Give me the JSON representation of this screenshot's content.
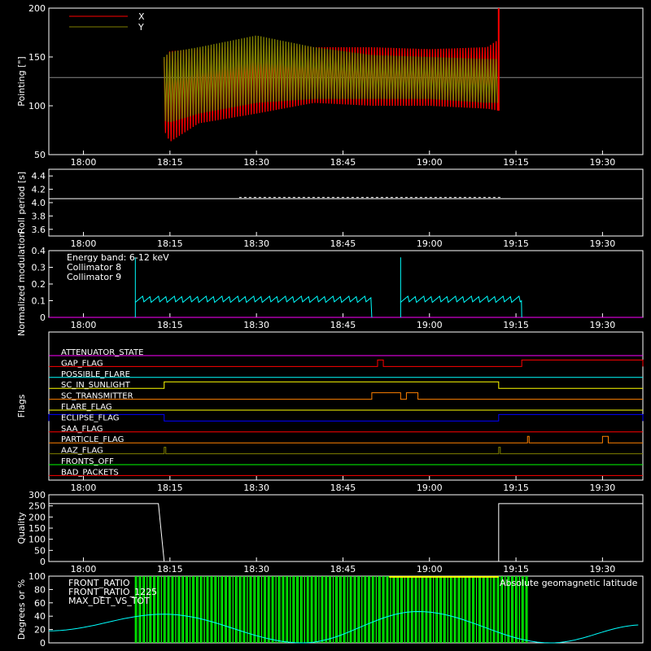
{
  "colors": {
    "background": "#000000",
    "axes": "#ffffff",
    "x_pointing": "#ff0000",
    "y_pointing": "#808000",
    "collimator8": "#00ffff",
    "collimator9": "#ff00ff",
    "front_ratio": "#ffff00",
    "front_ratio_1225": "#00ff00",
    "max_det": "#ff8000",
    "geomag": "#00ffff"
  },
  "time_axis": {
    "start": "17:54",
    "end": "19:37",
    "ticks": [
      "18:00",
      "18:15",
      "18:30",
      "18:45",
      "19:00",
      "19:15",
      "19:30"
    ]
  },
  "chart_data": [
    {
      "type": "line",
      "ylabel": "Pointing [\"]",
      "ylim": [
        50,
        200
      ],
      "yticks": [
        "50",
        "100",
        "150",
        "200"
      ],
      "legend_position": "top-left",
      "reference_line": 129,
      "series": [
        {
          "name": "X",
          "color": "#ff0000",
          "x": [
            "18:14",
            "18:15",
            "18:20",
            "18:30",
            "18:40",
            "18:50",
            "19:00",
            "19:10",
            "19:12"
          ],
          "upper": [
            148,
            156,
            158,
            162,
            160,
            160,
            158,
            160,
            168
          ],
          "lower": [
            75,
            63,
            82,
            92,
            103,
            100,
            100,
            97,
            95
          ]
        },
        {
          "name": "Y",
          "color": "#808000",
          "x": [
            "18:14",
            "18:15",
            "18:20",
            "18:30",
            "18:40",
            "18:50",
            "19:00",
            "19:10",
            "19:12"
          ],
          "upper": [
            150,
            155,
            160,
            172,
            160,
            152,
            150,
            148,
            148
          ],
          "lower": [
            85,
            83,
            92,
            103,
            107,
            107,
            107,
            103,
            103
          ]
        }
      ]
    },
    {
      "type": "line",
      "ylabel": "Roll period [s]",
      "ylim": [
        3.5,
        4.5
      ],
      "yticks": [
        "3.6",
        "3.8",
        "4.0",
        "4.2",
        "4.4"
      ],
      "series": [
        {
          "name": "",
          "x": [
            "17:54",
            "18:27",
            "19:12",
            "19:37"
          ],
          "values": [
            4.06,
            4.06,
            4.06,
            4.06
          ]
        }
      ]
    },
    {
      "type": "line",
      "ylabel": "Normalized modulation",
      "ylim": [
        0,
        0.4
      ],
      "yticks": [
        "0",
        "0.1",
        "0.2",
        "0.3",
        "0.4"
      ],
      "annotation": "Energy band: 6-12 keV",
      "series": [
        {
          "name": "Collimator 8",
          "color": "#00ffff",
          "x": [
            "18:09",
            "18:09",
            "18:50",
            "18:50",
            "18:55",
            "18:55",
            "19:16",
            "19:16"
          ],
          "values": [
            0,
            0.11,
            0.11,
            0,
            0,
            0.11,
            0.11,
            0
          ]
        },
        {
          "name": "Collimator 9",
          "color": "#ff00ff",
          "x": [
            "17:54",
            "19:37"
          ],
          "values": [
            0,
            0
          ]
        }
      ]
    },
    {
      "type": "line",
      "ylabel": "Flags",
      "series": [
        {
          "name": "ATTENUATOR_STATE",
          "color": "#ff00ff",
          "steps": []
        },
        {
          "name": "GAP_FLAG",
          "color": "#ff0000",
          "steps": [
            [
              "18:51",
              "18:52"
            ],
            [
              "19:16",
              "19:37"
            ]
          ]
        },
        {
          "name": "POSSIBLE_FLARE",
          "color": "#00ffff",
          "steps": []
        },
        {
          "name": "SC_IN_SUNLIGHT",
          "color": "#ffff00",
          "steps": [
            [
              "18:14",
              "19:12"
            ]
          ]
        },
        {
          "name": "SC_TRANSMITTER",
          "color": "#ff8000",
          "steps": [
            [
              "18:50",
              "18:55"
            ],
            [
              "18:56",
              "18:58"
            ]
          ]
        },
        {
          "name": "FLARE_FLAG",
          "color": "#ffff00",
          "steps": []
        },
        {
          "name": "ECLIPSE_FLAG",
          "color": "#0000ff",
          "steps": [
            [
              "17:54",
              "18:14"
            ],
            [
              "19:12",
              "19:37"
            ]
          ]
        },
        {
          "name": "SAA_FLAG",
          "color": "#ff0000",
          "steps": []
        },
        {
          "name": "PARTICLE_FLAG",
          "color": "#ff8000",
          "steps": [
            [
              "19:17",
              "19:17"
            ],
            [
              "19:30",
              "19:31"
            ]
          ]
        },
        {
          "name": "AAZ_FLAG",
          "color": "#808000",
          "steps": [
            [
              "18:14",
              "18:14"
            ],
            [
              "19:12",
              "19:12"
            ]
          ]
        },
        {
          "name": "FRONTS_OFF",
          "color": "#00ff00",
          "steps": []
        },
        {
          "name": "BAD_PACKETS",
          "color": "#ff0000",
          "steps": []
        }
      ]
    },
    {
      "type": "line",
      "ylabel": "Quality",
      "ylim": [
        0,
        300
      ],
      "yticks": [
        "0",
        "50",
        "100",
        "150",
        "200",
        "250",
        "300"
      ],
      "series": [
        {
          "name": "",
          "x": [
            "17:54",
            "18:13",
            "18:14",
            "19:12",
            "19:12",
            "19:37"
          ],
          "values": [
            260,
            260,
            0,
            0,
            260,
            260
          ]
        }
      ]
    },
    {
      "type": "area",
      "ylabel": "Degrees or %",
      "ylim": [
        0,
        100
      ],
      "yticks": [
        "0",
        "20",
        "40",
        "60",
        "80",
        "100"
      ],
      "series": [
        {
          "name": "FRONT_RATIO",
          "color": "#ffff00"
        },
        {
          "name": "FRONT_RATIO_1225",
          "color": "#00ff00",
          "x": [
            "18:09",
            "19:17"
          ],
          "values": [
            100,
            100
          ]
        },
        {
          "name": "MAX_DET_VS_TOT",
          "color": "#ff8000"
        },
        {
          "name": "Absolute geomagnetic latitude",
          "color": "#00ffff",
          "x": [
            "17:54",
            "18:14",
            "18:38",
            "18:58",
            "19:21",
            "19:37"
          ],
          "values": [
            18,
            43,
            0,
            47,
            0,
            27
          ]
        }
      ]
    }
  ]
}
